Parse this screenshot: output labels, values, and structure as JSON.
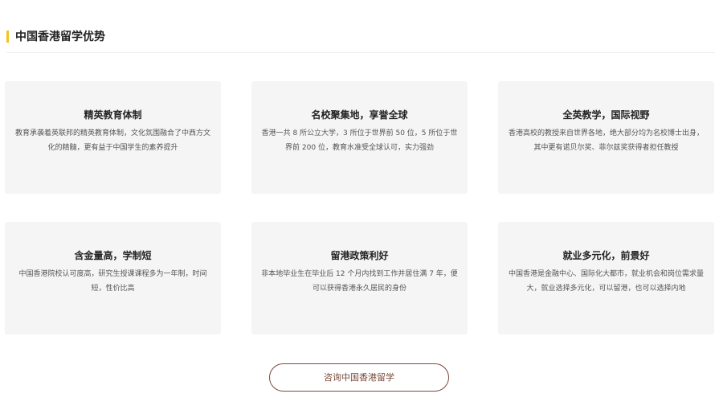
{
  "section": {
    "title": "中国香港留学优势"
  },
  "cards": [
    {
      "title": "精英教育体制",
      "desc": "教育承袭着英联邦的精英教育体制，文化氛围融合了中西方文化的精髓，更有益于中国学生的素养提升"
    },
    {
      "title": "名校聚集地，享誉全球",
      "desc": "香港一共 8 所公立大学，3 所位于世界前 50 位，5 所位于世界前 200 位，教育水准受全球认可，实力强劲"
    },
    {
      "title": "全英教学，国际视野",
      "desc": "香港高校的教授来自世界各地，绝大部分均为名校博士出身，其中更有诺贝尔奖、菲尔兹奖获得者担任教授"
    },
    {
      "title": "含金量高，学制短",
      "desc": "中国香港院校认可度高，研究生授课课程多为一年制，时间短，性价比高"
    },
    {
      "title": "留港政策利好",
      "desc": "非本地毕业生在毕业后 12 个月内找到工作并居住满 7 年，便可以获得香港永久居民的身份"
    },
    {
      "title": "就业多元化，前景好",
      "desc": "中国香港是金融中心、国际化大都市，就业机会和岗位需求量大，就业选择多元化，可以留港，也可以选择内地"
    }
  ],
  "cta": {
    "label": "咨询中国香港留学"
  },
  "colors": {
    "accent": "#f2c41a",
    "card_bg": "#f5f5f5",
    "button_border": "#7a4a3a"
  }
}
